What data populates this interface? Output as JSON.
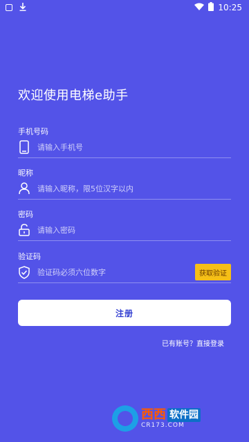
{
  "status_bar": {
    "time": "10:25"
  },
  "page": {
    "title": "欢迎使用电梯e助手"
  },
  "fields": {
    "phone": {
      "label": "手机号码",
      "placeholder": "请输入手机号"
    },
    "nickname": {
      "label": "昵称",
      "placeholder": "请输入昵称，限5位汉字以内"
    },
    "password": {
      "label": "密码",
      "placeholder": "请输入密码"
    },
    "code": {
      "label": "验证码",
      "placeholder": "验证码必须六位数字",
      "button": "获取验证"
    }
  },
  "actions": {
    "register": "注册",
    "login_link": "已有账号？直接登录"
  },
  "watermark": {
    "brand": "西西软件园",
    "brand_part1": "西西",
    "brand_part2": "软件园",
    "domain": "CR173.COM"
  },
  "colors": {
    "background": "#5353e8",
    "accent_button": "#f5bf17",
    "primary_text": "#2f3bd0"
  },
  "icons": [
    "phone-icon",
    "user-icon",
    "lock-icon",
    "shield-check-icon",
    "download-icon",
    "wifi-icon",
    "battery-icon"
  ]
}
